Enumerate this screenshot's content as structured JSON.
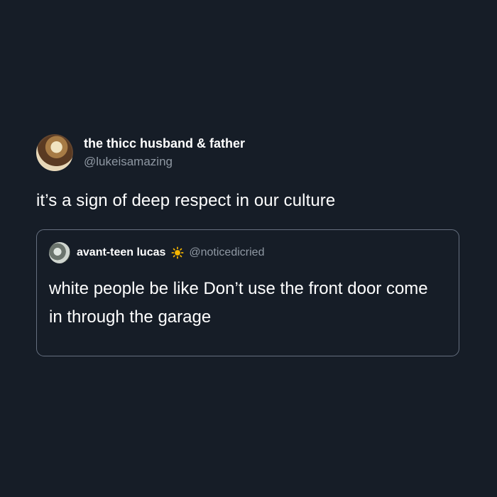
{
  "tweet": {
    "author": {
      "display_name": "the thicc husband & father",
      "handle": "@lukeisamazing",
      "avatar_icon": "profile-photo-icon"
    },
    "text": "it’s a sign of deep respect in our culture"
  },
  "quote": {
    "author": {
      "display_name": "avant-teen lucas",
      "emoji_icon": "sun-icon",
      "handle": "@noticedicried",
      "avatar_icon": "profile-photo-icon"
    },
    "text": "white people be like Don’t use the front door come in through the garage"
  },
  "colors": {
    "background": "#161d27",
    "primary_text": "#ffffff",
    "secondary_text": "#8f98a3",
    "quote_border": "#667080",
    "sun": "#f4b400"
  }
}
